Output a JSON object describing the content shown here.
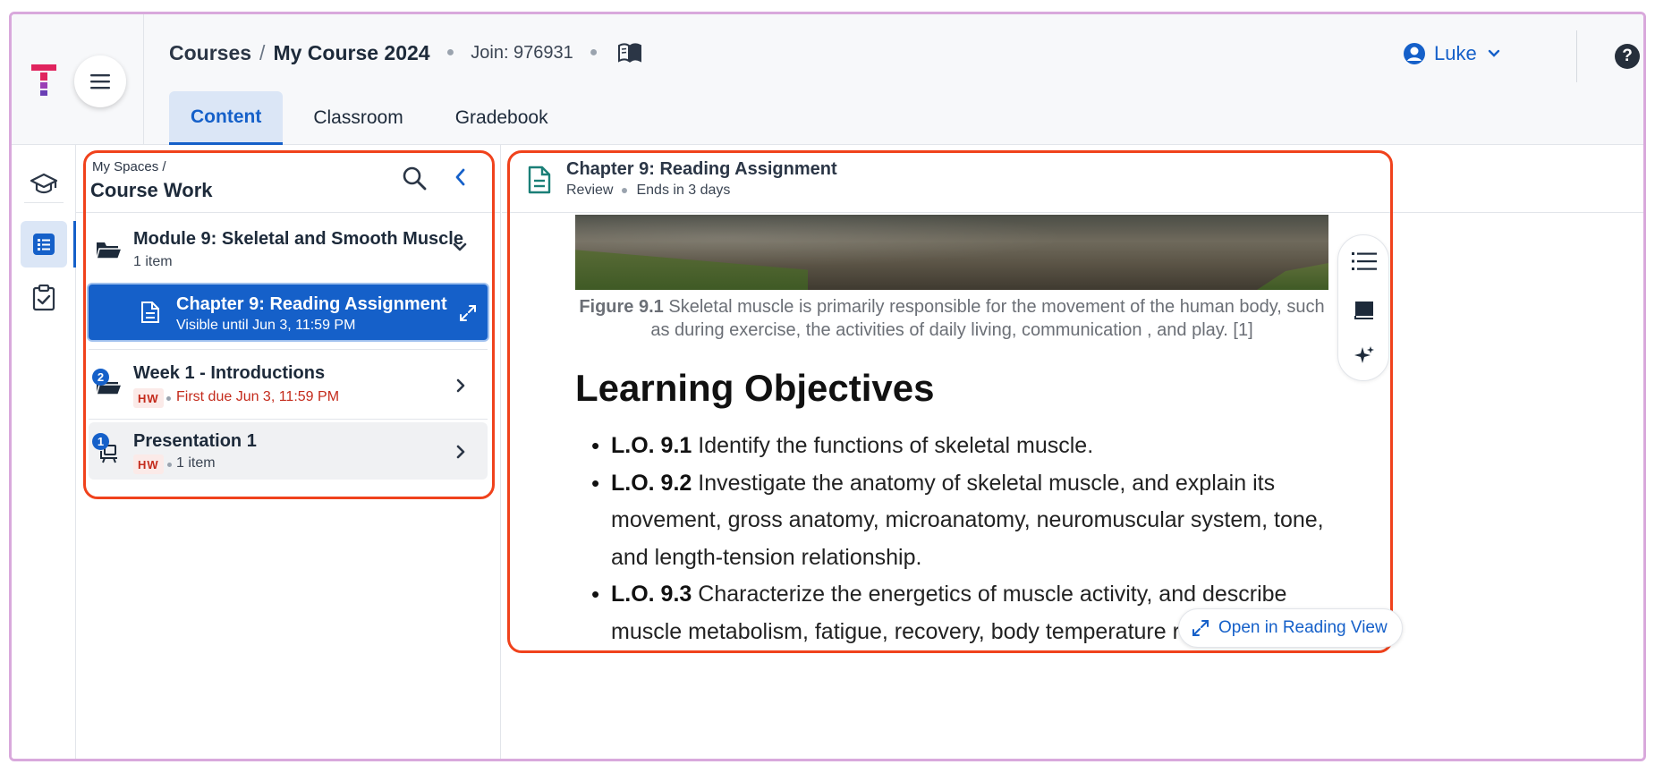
{
  "colors": {
    "primary": "#1560c9",
    "highlight_border": "#f0421c",
    "hw_text": "#c42b1c",
    "due_text": "#c42b1c"
  },
  "header": {
    "breadcrumb_root": "Courses",
    "breadcrumb_sep": "/",
    "course_name": "My Course 2024",
    "join_code": "Join: 976931",
    "user_name": "Luke",
    "help_label": "?"
  },
  "tabs": [
    {
      "label": "Content",
      "active": true
    },
    {
      "label": "Classroom",
      "active": false
    },
    {
      "label": "Gradebook",
      "active": false
    }
  ],
  "rail": {
    "items": [
      {
        "icon": "graduation-cap-icon"
      },
      {
        "icon": "list-icon",
        "active": true
      },
      {
        "icon": "clipboard-check-icon"
      }
    ]
  },
  "coursework": {
    "crumb": "My Spaces  /",
    "title": "Course Work",
    "module": {
      "title": "Module 9: Skeletal and Smooth Muscle",
      "count": "1 item"
    },
    "selected": {
      "title": "Chapter 9: Reading Assignment",
      "sub": "Visible until Jun 3, 11:59 PM"
    },
    "week": {
      "badge": "2",
      "title": "Week 1 - Introductions",
      "hw": "HW",
      "due": "First due Jun 3, 11:59 PM"
    },
    "presentation": {
      "badge": "1",
      "title": "Presentation 1",
      "hw": "HW",
      "count": "1 item"
    }
  },
  "viewer": {
    "title": "Chapter 9: Reading Assignment",
    "status": "Review",
    "ends": "Ends in 3 days",
    "figure_label": "Figure 9.1",
    "figure_caption": "Skeletal muscle is primarily responsible for the movement of the human body, such as during exercise, the activities of daily living, communication , and play. [1]",
    "heading": "Learning Objectives",
    "objectives": [
      {
        "code": "L.O. 9.1",
        "text": "Identify the functions of skeletal muscle."
      },
      {
        "code": "L.O. 9.2",
        "text": "Investigate the anatomy of skeletal muscle, and explain its movement, gross anatomy, microanatomy, neuromuscular system, tone, and length-tension relationship."
      },
      {
        "code": "L.O. 9.3",
        "text": "Characterize the energetics of muscle activity, and describe muscle metabolism, fatigue, recovery, body temperature regulation,"
      }
    ],
    "open_reading_label": "Open in Reading View"
  }
}
